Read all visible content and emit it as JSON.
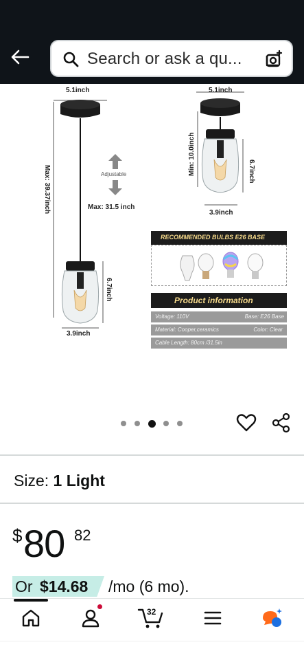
{
  "search": {
    "placeholder": "Search or ask a qu..."
  },
  "gallery": {
    "dims": {
      "top_width_left": "5.1inch",
      "top_width_right": "5.1inch",
      "max_length": "Max: 39.37inch",
      "adjustable": "Adjustable",
      "max_cord": "Max: 31.5 inch",
      "jar_height_left": "6.7inch",
      "jar_width_left": "3.9inch",
      "min_length": "Min: 10.0inch",
      "jar_height_right": "6.7inch",
      "jar_width_right": "3.9inch"
    },
    "recommended_title": "RECOMMENDED BULBS E26  BASE",
    "product_info_title": "Product  information",
    "info_rows": [
      {
        "left": "Voltage: 110V",
        "right": "Base: E26 Base"
      },
      {
        "left": "Material: Cooper,ceramics",
        "right": "Color: Clear"
      },
      {
        "left": "Cable Length: 80cm /31.5in",
        "right": ""
      }
    ],
    "page_count": 5,
    "active_page": 3
  },
  "size": {
    "label": "Size:",
    "value": "1 Light"
  },
  "price": {
    "currency": "$",
    "whole": "80",
    "fraction": "82"
  },
  "monthly": {
    "or": "Or",
    "amount": "$14.68",
    "rest": "/mo (6 mo)."
  },
  "nav": {
    "cart_count": "32"
  },
  "colors": {
    "header_bg": "#0f1419",
    "highlight": "#c6ede6",
    "badge": "#cc0c39",
    "assistant_orange": "#ff6a1a",
    "assistant_blue": "#1c6fe0"
  }
}
